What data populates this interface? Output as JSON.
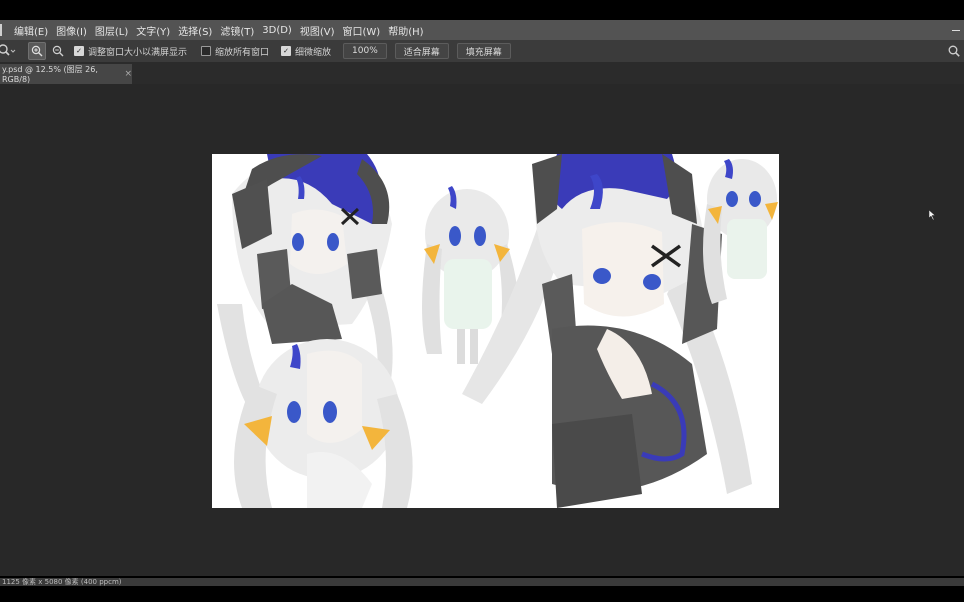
{
  "menubar": {
    "items": [
      "编辑(E)",
      "图像(I)",
      "图层(L)",
      "文字(Y)",
      "选择(S)",
      "滤镜(T)",
      "3D(D)",
      "视图(V)",
      "窗口(W)",
      "帮助(H)"
    ]
  },
  "options": {
    "resize_windows_label": "调整窗口大小以满屏显示",
    "resize_windows_checked": true,
    "zoom_all_label": "缩放所有窗口",
    "zoom_all_checked": false,
    "scrubby_zoom_label": "细微缩放",
    "scrubby_zoom_checked": true,
    "zoom_value": "100%",
    "fit_screen_label": "适合屏幕",
    "fill_screen_label": "填充屏幕"
  },
  "tab": {
    "title": "y.psd @ 12.5% (图层 26, RGB/8)",
    "close": "×"
  },
  "status": {
    "text": "1125 像素 x 5080 像素 (400 ppcm)"
  },
  "icons": {
    "zoom_tool": "zoom-tool-icon",
    "zoom_in": "zoom-in-icon",
    "zoom_out": "zoom-out-icon",
    "search": "search-icon"
  },
  "colors": {
    "workspace": "#282828",
    "menubar": "#535353",
    "options_bar": "#3b3b3b",
    "accent_blue": "#3a3bb8",
    "hair": "#e4e4e4",
    "dark_cloth": "#4a4a4a",
    "orange_bow": "#f3b53c"
  }
}
